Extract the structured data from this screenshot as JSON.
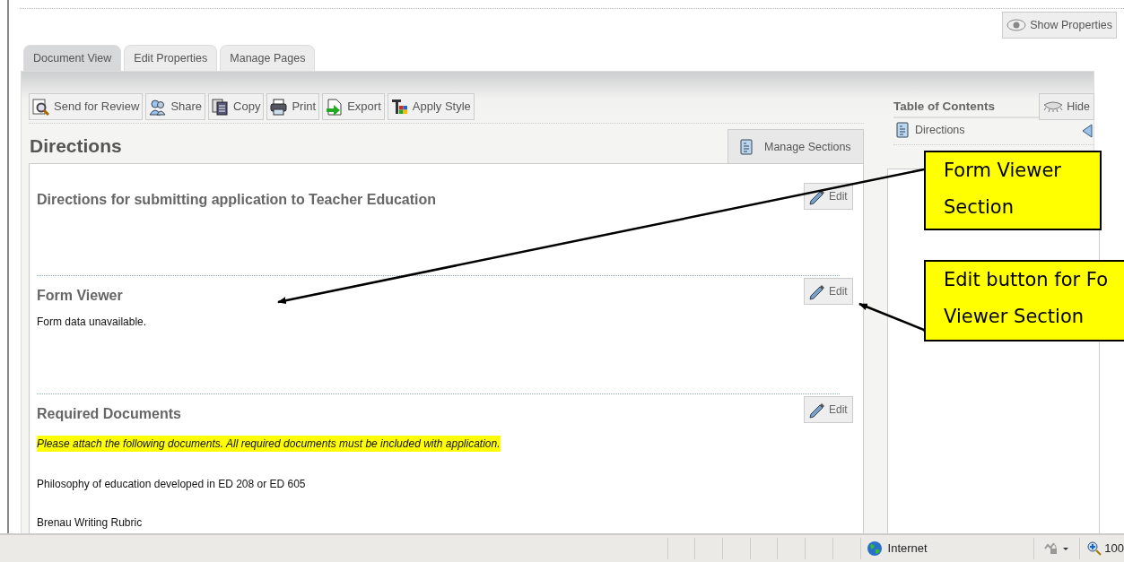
{
  "header": {
    "show_properties": "Show Properties"
  },
  "tabs": [
    {
      "label": "Document View",
      "selected": true
    },
    {
      "label": "Edit Properties",
      "selected": false
    },
    {
      "label": "Manage Pages",
      "selected": false
    }
  ],
  "toolbar": [
    {
      "label": "Send for Review",
      "kind": "review"
    },
    {
      "label": "Share",
      "kind": "share"
    },
    {
      "label": "Copy",
      "kind": "copy"
    },
    {
      "label": "Print",
      "kind": "print"
    },
    {
      "label": "Export",
      "kind": "export"
    },
    {
      "label": "Apply Style",
      "kind": "style"
    }
  ],
  "page_title": "Directions",
  "manage_sections": "Manage Sections",
  "sections": [
    {
      "title": "Directions for submitting application to Teacher Education",
      "edit": "Edit"
    },
    {
      "title": "Form Viewer",
      "edit": "Edit",
      "paragraphs": [
        {
          "text": "Form data unavailable.",
          "highlighted": false
        }
      ]
    },
    {
      "title": "Required Documents",
      "edit": "Edit",
      "paragraphs": [
        {
          "text": "Please attach the following documents.  All required documents must be included with application.",
          "highlighted": true
        },
        {
          "text": "Philosophy of education developed in ED 208 or ED 605",
          "highlighted": false
        },
        {
          "text": "Brenau Writing Rubric",
          "highlighted": false
        }
      ]
    }
  ],
  "toc": {
    "title": "Table of Contents",
    "hide": "Hide",
    "items": [
      {
        "label": "Directions"
      }
    ]
  },
  "callouts": [
    {
      "lines": [
        "Form Viewer",
        "Section"
      ]
    },
    {
      "lines": [
        "Edit button for Fo",
        "Viewer Section"
      ]
    }
  ],
  "status_bar": {
    "zone": "Internet",
    "zoom": "100"
  }
}
